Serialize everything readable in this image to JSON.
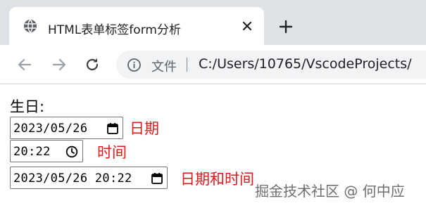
{
  "browser": {
    "tab": {
      "title": "HTML表单标签form分析"
    },
    "address_bar": {
      "security_label": "文件",
      "url": "C:/Users/10765/VscodeProjects/"
    }
  },
  "form": {
    "birthday_label": "生日:",
    "date_input": {
      "value": "2023/05/26",
      "caption": "日期"
    },
    "time_input": {
      "value": "20:22",
      "caption": "时间"
    },
    "datetime_input": {
      "value": "2023/05/26 20:22",
      "caption": "日期和时间"
    }
  },
  "watermark": "掘金技术社区 @ 何中应",
  "icons": {
    "tab_favicon": "globe-icon",
    "tab_close": "close-icon",
    "new_tab": "plus-icon",
    "back": "back-arrow-icon",
    "forward": "forward-arrow-icon",
    "reload": "reload-icon",
    "info": "info-icon",
    "calendar": "calendar-icon",
    "clock": "clock-icon"
  },
  "colors": {
    "tabstrip_bg": "#dee1e6",
    "omnibox_bg": "#f1f3f4",
    "caption_red": "#e21818"
  }
}
